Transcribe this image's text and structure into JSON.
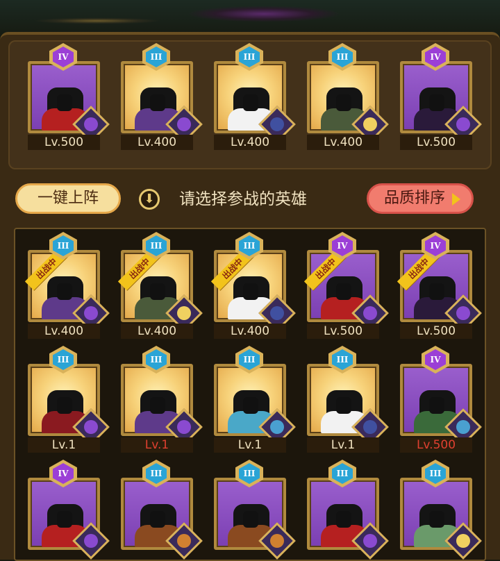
{
  "team": [
    {
      "rank": "IV",
      "bg": "purple",
      "fig": "#b52020",
      "faction": "#8a4ad0",
      "level": "Lv.500"
    },
    {
      "rank": "III",
      "bg": "gold",
      "fig": "#5e3a8a",
      "faction": "#8a4ad0",
      "level": "Lv.400"
    },
    {
      "rank": "III",
      "bg": "gold",
      "fig": "#f2f2f2",
      "faction": "#4050a0",
      "level": "Lv.400"
    },
    {
      "rank": "III",
      "bg": "gold",
      "fig": "#4a5a3a",
      "faction": "#f0d060",
      "level": "Lv.400"
    },
    {
      "rank": "IV",
      "bg": "purple",
      "fig": "#2a1a3a",
      "faction": "#8a4ad0",
      "level": "Lv.500"
    }
  ],
  "controls": {
    "auto_deploy": "一键上阵",
    "tip": "请选择参战的英雄",
    "sort": "品质排序",
    "info_icon": "⬇"
  },
  "deployed_label": "出战中",
  "heroes": [
    {
      "rank": "III",
      "bg": "gold",
      "fig": "#5e3a8a",
      "faction": "#8a4ad0",
      "level": "Lv.400",
      "deployed": true,
      "red": false
    },
    {
      "rank": "III",
      "bg": "gold",
      "fig": "#4a5a3a",
      "faction": "#f0d060",
      "level": "Lv.400",
      "deployed": true,
      "red": false
    },
    {
      "rank": "III",
      "bg": "gold",
      "fig": "#f2f2f2",
      "faction": "#4050a0",
      "level": "Lv.400",
      "deployed": true,
      "red": false
    },
    {
      "rank": "IV",
      "bg": "purple",
      "fig": "#b52020",
      "faction": "#8a4ad0",
      "level": "Lv.500",
      "deployed": true,
      "red": false
    },
    {
      "rank": "IV",
      "bg": "purple",
      "fig": "#2a1a3a",
      "faction": "#8a4ad0",
      "level": "Lv.500",
      "deployed": true,
      "red": false
    },
    {
      "rank": "III",
      "bg": "gold",
      "fig": "#8a1a20",
      "faction": "#8a4ad0",
      "level": "Lv.1",
      "deployed": false,
      "red": false
    },
    {
      "rank": "III",
      "bg": "gold",
      "fig": "#5e3a8a",
      "faction": "#8a4ad0",
      "level": "Lv.1",
      "deployed": false,
      "red": true
    },
    {
      "rank": "III",
      "bg": "gold",
      "fig": "#4aa8c8",
      "faction": "#4aa0d0",
      "level": "Lv.1",
      "deployed": false,
      "red": false
    },
    {
      "rank": "III",
      "bg": "gold",
      "fig": "#f2f2f2",
      "faction": "#4050a0",
      "level": "Lv.1",
      "deployed": false,
      "red": false
    },
    {
      "rank": "IV",
      "bg": "purple",
      "fig": "#3a6a3a",
      "faction": "#4aa0d0",
      "level": "Lv.500",
      "deployed": false,
      "red": true
    },
    {
      "rank": "IV",
      "bg": "purple",
      "fig": "#b52020",
      "faction": "#8a4ad0",
      "level": "",
      "deployed": false,
      "red": false
    },
    {
      "rank": "III",
      "bg": "purple",
      "fig": "#8a4a20",
      "faction": "#d08030",
      "level": "",
      "deployed": false,
      "red": false
    },
    {
      "rank": "III",
      "bg": "purple",
      "fig": "#8a4a20",
      "faction": "#d08030",
      "level": "",
      "deployed": false,
      "red": false
    },
    {
      "rank": "III",
      "bg": "purple",
      "fig": "#b52020",
      "faction": "#8a4ad0",
      "level": "",
      "deployed": false,
      "red": false
    },
    {
      "rank": "III",
      "bg": "purple",
      "fig": "#6a9a6a",
      "faction": "#f0d060",
      "level": "",
      "deployed": false,
      "red": false
    }
  ]
}
